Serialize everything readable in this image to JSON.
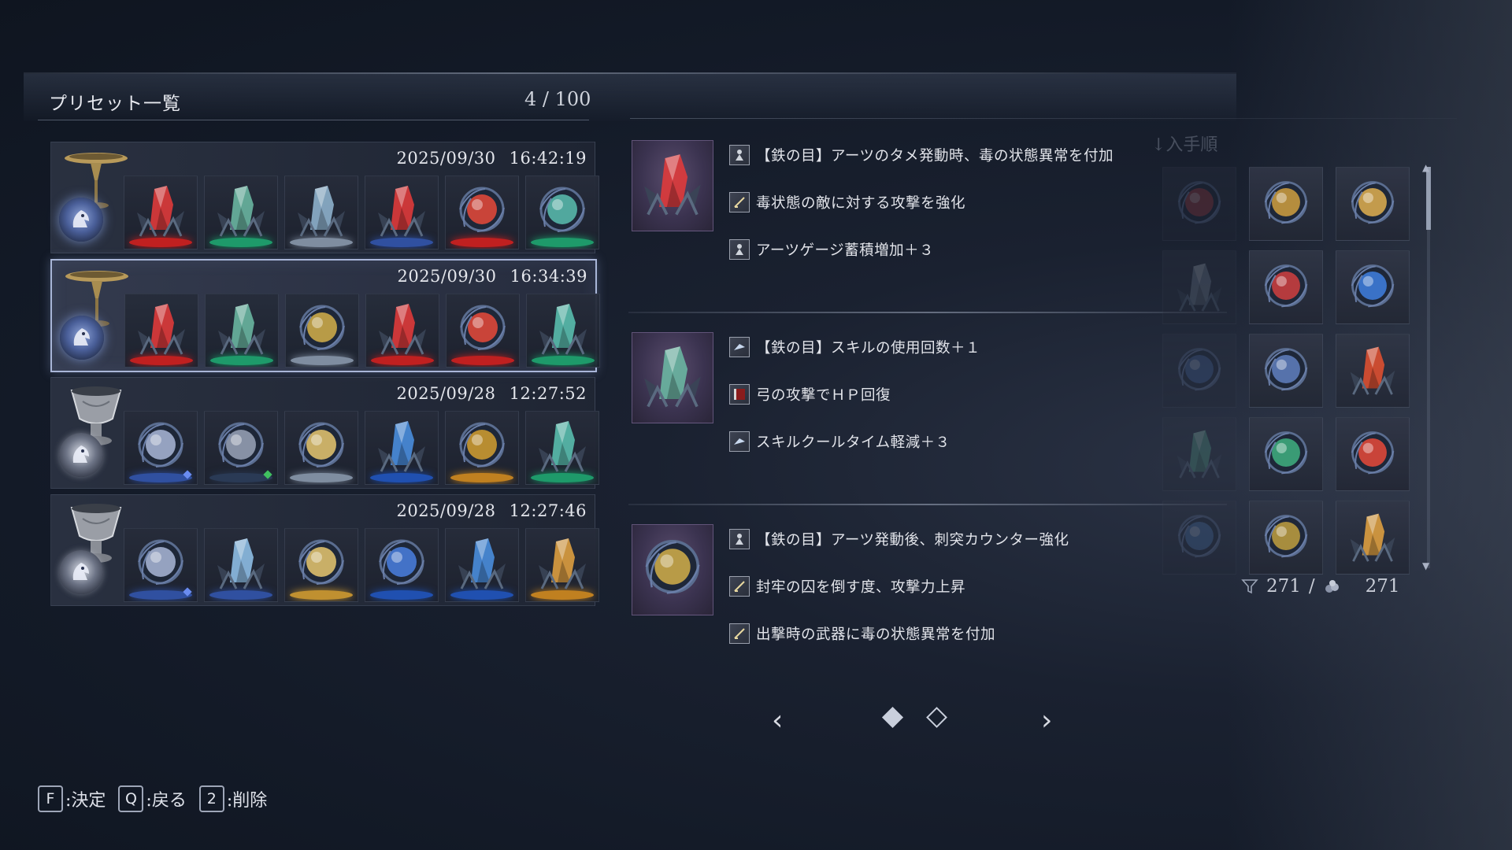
{
  "header": {
    "title": "プリセット一覧",
    "count": "4 / 100",
    "sort_label": "↓入手順"
  },
  "presets": [
    {
      "date": "2025/09/30  16:42:19",
      "vessel": "golden-chalice",
      "selected": false,
      "gems": [
        {
          "type": "crystal",
          "color": "#e33a3a",
          "glow": "#c02020"
        },
        {
          "type": "crystal",
          "color": "#6bb8a3",
          "glow": "#1e9a6a"
        },
        {
          "type": "crystal",
          "color": "#8fb4cf",
          "glow": "#7f8da0"
        },
        {
          "type": "crystal",
          "color": "#e33a3a",
          "glow": "#3050a0"
        },
        {
          "type": "orb",
          "color": "#e84a3a",
          "glow": "#c02020"
        },
        {
          "type": "orb",
          "color": "#5ac0b0",
          "glow": "#1e9a6a"
        }
      ]
    },
    {
      "date": "2025/09/30  16:34:39",
      "vessel": "golden-chalice",
      "selected": true,
      "gems": [
        {
          "type": "crystal",
          "color": "#e33a3a",
          "glow": "#c02020"
        },
        {
          "type": "crystal",
          "color": "#6bb8a3",
          "glow": "#1e9a6a"
        },
        {
          "type": "orb",
          "color": "#d4b04a",
          "glow": "#7f8da0"
        },
        {
          "type": "crystal",
          "color": "#e33a3a",
          "glow": "#c02020"
        },
        {
          "type": "orb",
          "color": "#e84a3a",
          "glow": "#c02020"
        },
        {
          "type": "crystal",
          "color": "#5ac0b0",
          "glow": "#1e9a6a"
        }
      ]
    },
    {
      "date": "2025/09/28  12:27:52",
      "vessel": "stone-urn",
      "selected": false,
      "gems": [
        {
          "type": "orb",
          "color": "#aab8d8",
          "glow": "#3050a0",
          "dot": "#6a8cf0"
        },
        {
          "type": "orb",
          "color": "#9aa4b8",
          "glow": "#2a3a55",
          "dot": "#40c060"
        },
        {
          "type": "orb",
          "color": "#e8c870",
          "glow": "#7f8da0"
        },
        {
          "type": "crystal",
          "color": "#4a90e0",
          "glow": "#2050b0"
        },
        {
          "type": "orb",
          "color": "#d4a030",
          "glow": "#c08020"
        },
        {
          "type": "crystal",
          "color": "#5ac0b0",
          "glow": "#1e9a6a"
        }
      ]
    },
    {
      "date": "2025/09/28  12:27:46",
      "vessel": "stone-urn",
      "selected": false,
      "gems": [
        {
          "type": "orb",
          "color": "#aab8d8",
          "glow": "#3050a0",
          "dot": "#6a8cf0"
        },
        {
          "type": "crystal",
          "color": "#8fc0e8",
          "glow": "#3050a0"
        },
        {
          "type": "orb",
          "color": "#e8c870",
          "glow": "#c09030"
        },
        {
          "type": "orb",
          "color": "#4a80e0",
          "glow": "#2050b0"
        },
        {
          "type": "crystal",
          "color": "#4a90e0",
          "glow": "#2050b0"
        },
        {
          "type": "crystal",
          "color": "#e0a040",
          "glow": "#c08020"
        }
      ]
    }
  ],
  "details": [
    {
      "icon": {
        "type": "crystal",
        "color": "#e33a3a"
      },
      "effects": [
        {
          "icon": "figure",
          "text": "【鉄の目】アーツのタメ発動時、毒の状態異常を付加"
        },
        {
          "icon": "sword",
          "text": "毒状態の敵に対する攻撃を強化"
        },
        {
          "icon": "figure",
          "text": "アーツゲージ蓄積増加＋３"
        }
      ]
    },
    {
      "icon": {
        "type": "crystal",
        "color": "#6bb8a3"
      },
      "effects": [
        {
          "icon": "bird",
          "text": "【鉄の目】スキルの使用回数＋１"
        },
        {
          "icon": "red",
          "text": "弓の攻撃でＨＰ回復"
        },
        {
          "icon": "bird",
          "text": "スキルクールタイム軽減＋３"
        }
      ]
    },
    {
      "icon": {
        "type": "orb",
        "color": "#d4b04a"
      },
      "effects": [
        {
          "icon": "figure",
          "text": "【鉄の目】アーツ発動後、刺突カウンター強化"
        },
        {
          "icon": "sword",
          "text": "封牢の囚を倒す度、攻撃力上昇"
        },
        {
          "icon": "sword",
          "text": "出撃時の武器に毒の状態異常を付加"
        }
      ]
    }
  ],
  "inventory": [
    {
      "type": "orb",
      "color": "#c04040",
      "faded": true
    },
    {
      "type": "orb",
      "color": "#d0a040"
    },
    {
      "type": "orb",
      "color": "#e0b050"
    },
    {
      "type": "crystal",
      "color": "#8090a0",
      "faded": true
    },
    {
      "type": "orb",
      "color": "#d04040"
    },
    {
      "type": "orb",
      "color": "#4080e0"
    },
    {
      "type": "orb",
      "color": "#4a70b0",
      "faded": true
    },
    {
      "type": "orb",
      "color": "#6080c0"
    },
    {
      "type": "crystal",
      "color": "#e05030"
    },
    {
      "type": "crystal",
      "color": "#5ab090",
      "faded": true
    },
    {
      "type": "orb",
      "color": "#40b080"
    },
    {
      "type": "orb",
      "color": "#e84a3a"
    },
    {
      "type": "orb",
      "color": "#5080c0",
      "faded": true
    },
    {
      "type": "orb",
      "color": "#c0a040"
    },
    {
      "type": "crystal",
      "color": "#e0a040"
    }
  ],
  "tally": {
    "current": "271",
    "separator": "/",
    "max": "271"
  },
  "pager": {
    "prev": "‹",
    "next": "›",
    "pages": 2,
    "active": 0
  },
  "footer": [
    {
      "key": "F",
      "label": ":決定"
    },
    {
      "key": "Q",
      "label": ":戻る"
    },
    {
      "key": "2",
      "label": ":削除"
    }
  ]
}
